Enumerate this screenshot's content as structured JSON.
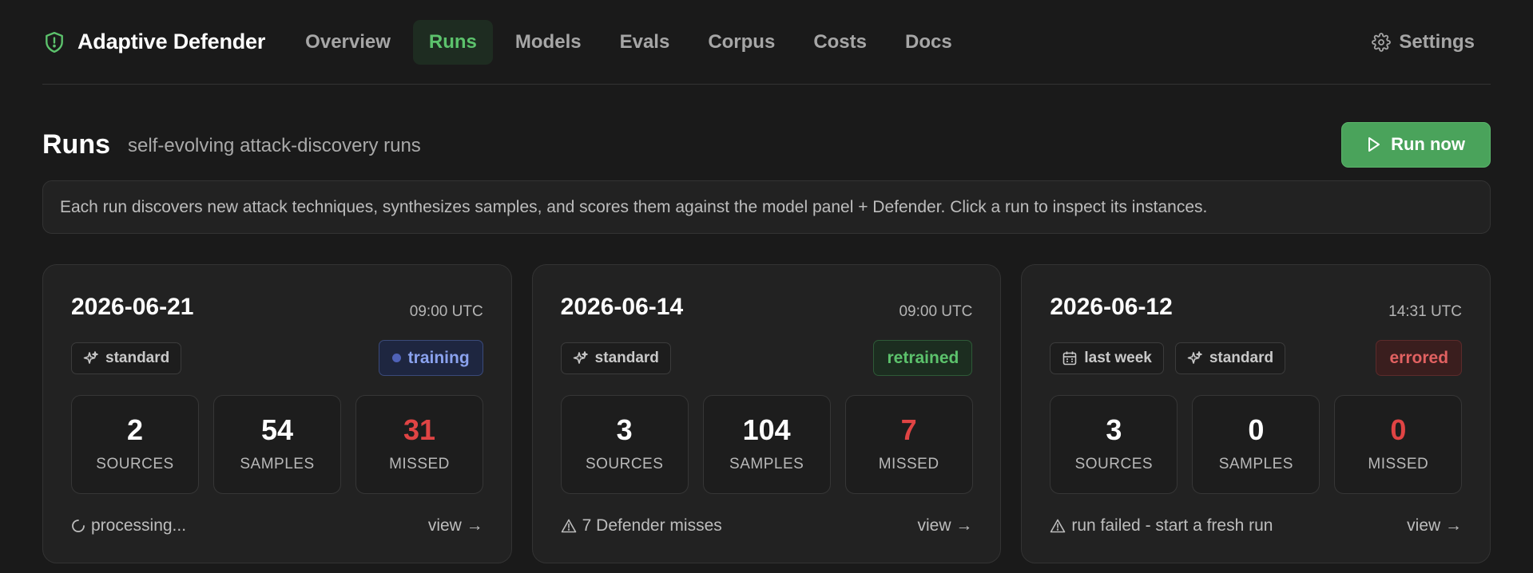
{
  "header": {
    "brand": "Adaptive Defender",
    "nav": [
      {
        "label": "Overview",
        "active": false
      },
      {
        "label": "Runs",
        "active": true
      },
      {
        "label": "Models",
        "active": false
      },
      {
        "label": "Evals",
        "active": false
      },
      {
        "label": "Corpus",
        "active": false
      },
      {
        "label": "Costs",
        "active": false
      },
      {
        "label": "Docs",
        "active": false
      }
    ],
    "settings_label": "Settings"
  },
  "page": {
    "title": "Runs",
    "subtitle": "self-evolving attack-discovery runs",
    "run_now_label": "Run now",
    "info": "Each run discovers new attack techniques, synthesizes samples, and scores them against the model panel + Defender. Click a run to inspect its instances."
  },
  "colors": {
    "accent_green": "#4aa35b",
    "status_training": "#8aa2ee",
    "status_retrained": "#5cc26c",
    "status_errored": "#e16161",
    "missed_red": "#e04444"
  },
  "runs": [
    {
      "date": "2026-06-21",
      "time": "09:00 UTC",
      "tags": [
        {
          "icon": "sparkle-icon",
          "label": "standard"
        }
      ],
      "status": "training",
      "stats": [
        {
          "value": "2",
          "label": "SOURCES"
        },
        {
          "value": "54",
          "label": "SAMPLES"
        },
        {
          "value": "31",
          "label": "MISSED"
        }
      ],
      "footer_icon": "spinner-icon",
      "footer": "processing...",
      "view_label": "view →"
    },
    {
      "date": "2026-06-14",
      "time": "09:00 UTC",
      "tags": [
        {
          "icon": "sparkle-icon",
          "label": "standard"
        }
      ],
      "status": "retrained",
      "stats": [
        {
          "value": "3",
          "label": "SOURCES"
        },
        {
          "value": "104",
          "label": "SAMPLES"
        },
        {
          "value": "7",
          "label": "MISSED"
        }
      ],
      "footer_icon": "warning-icon",
      "footer": "7 Defender misses",
      "view_label": "view →"
    },
    {
      "date": "2026-06-12",
      "time": "14:31 UTC",
      "tags": [
        {
          "icon": "calendar-icon",
          "label": "last week"
        },
        {
          "icon": "sparkle-icon",
          "label": "standard"
        }
      ],
      "status": "errored",
      "stats": [
        {
          "value": "3",
          "label": "SOURCES"
        },
        {
          "value": "0",
          "label": "SAMPLES"
        },
        {
          "value": "0",
          "label": "MISSED"
        }
      ],
      "footer_icon": "warning-icon",
      "footer": "run failed - start a fresh run",
      "view_label": "view →"
    }
  ]
}
